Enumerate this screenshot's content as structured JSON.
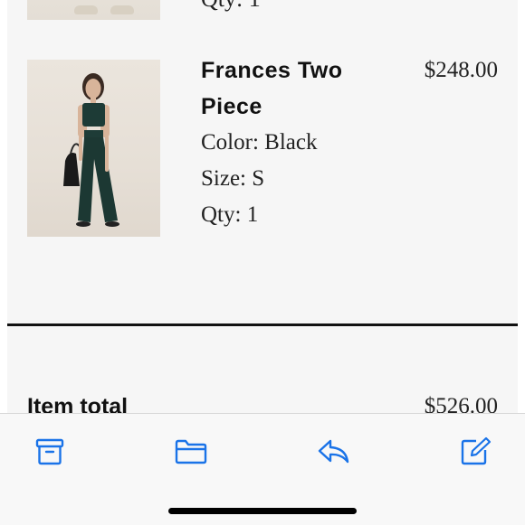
{
  "previous_item": {
    "qty": "Qty: 1"
  },
  "item": {
    "name": "Frances Two Piece",
    "price": "$248.00",
    "color": "Color: Black",
    "size": "Size: S",
    "qty": "Qty: 1"
  },
  "summary": {
    "item_total_label": "Item total",
    "item_total_value": "$526.00"
  },
  "toolbar": {
    "icons": [
      "archive-icon",
      "folder-icon",
      "reply-icon",
      "compose-icon"
    ],
    "accent_color": "#1a73e8"
  }
}
